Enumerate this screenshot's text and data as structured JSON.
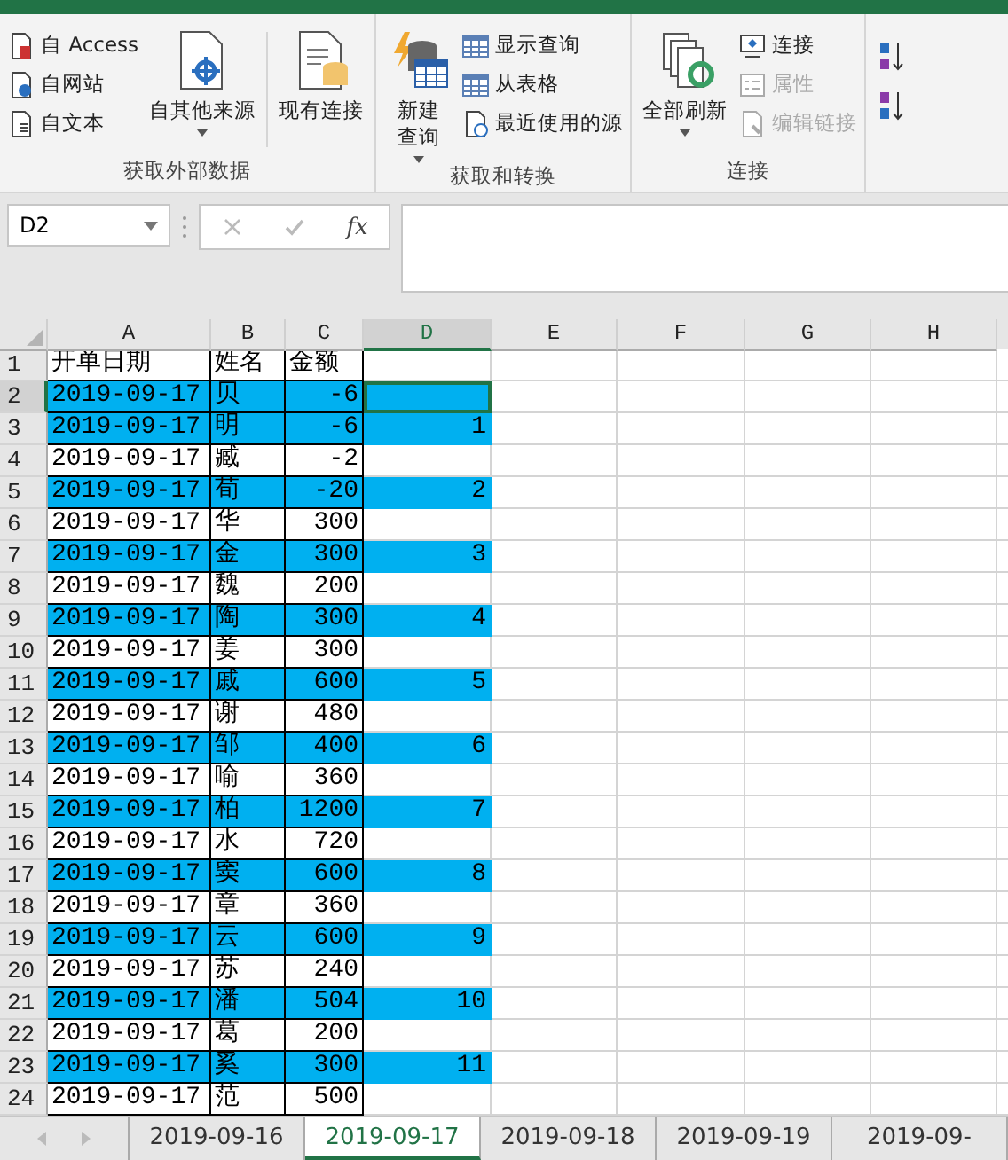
{
  "ribbon": {
    "groups": [
      {
        "label": "获取外部数据",
        "items": [
          {
            "kind": "stack",
            "buttons": [
              {
                "label": "自 Access",
                "disabled": false
              },
              {
                "label": "自网站",
                "disabled": false
              },
              {
                "label": "自文本",
                "disabled": false
              }
            ]
          },
          {
            "kind": "large",
            "lines": [
              "自其他来源"
            ],
            "dropdown": true
          },
          {
            "kind": "separator"
          },
          {
            "kind": "large",
            "lines": [
              "现有连接"
            ],
            "dropdown": false
          }
        ]
      },
      {
        "label": "获取和转换",
        "items": [
          {
            "kind": "large",
            "lines": [
              "新建",
              "查询"
            ],
            "dropdown": true
          },
          {
            "kind": "stack",
            "buttons": [
              {
                "label": "显示查询",
                "disabled": false
              },
              {
                "label": "从表格",
                "disabled": false
              },
              {
                "label": "最近使用的源",
                "disabled": false
              }
            ]
          }
        ]
      },
      {
        "label": "连接",
        "items": [
          {
            "kind": "large",
            "lines": [
              "全部刷新"
            ],
            "dropdown": true
          },
          {
            "kind": "stack",
            "buttons": [
              {
                "label": "连接",
                "disabled": false
              },
              {
                "label": "属性",
                "disabled": true
              },
              {
                "label": "编辑链接",
                "disabled": true
              }
            ]
          }
        ]
      }
    ]
  },
  "formula_bar": {
    "name_box": "D2",
    "fx": "fx"
  },
  "columns": [
    {
      "label": "A",
      "selected": false
    },
    {
      "label": "B",
      "selected": false
    },
    {
      "label": "C",
      "selected": false
    },
    {
      "label": "D",
      "selected": true
    },
    {
      "label": "E",
      "selected": false
    },
    {
      "label": "F",
      "selected": false
    },
    {
      "label": "G",
      "selected": false
    },
    {
      "label": "H",
      "selected": false
    }
  ],
  "header_row": {
    "num": "1",
    "cells": [
      "开单日期",
      "姓名",
      "金额"
    ]
  },
  "rows": [
    {
      "num": "2",
      "date": "2019-09-17",
      "name": "贝",
      "amount": "-6",
      "highlighted": true,
      "selected": true
    },
    {
      "num": "3",
      "date": "2019-09-17",
      "name": "明",
      "amount": "-6",
      "d": "1",
      "highlighted": true,
      "selected": false
    },
    {
      "num": "4",
      "date": "2019-09-17",
      "name": "臧",
      "amount": "-2",
      "highlighted": false,
      "selected": false
    },
    {
      "num": "5",
      "date": "2019-09-17",
      "name": "荀",
      "amount": "-20",
      "d": "2",
      "highlighted": true,
      "selected": false
    },
    {
      "num": "6",
      "date": "2019-09-17",
      "name": "华",
      "amount": "300",
      "highlighted": false,
      "selected": false
    },
    {
      "num": "7",
      "date": "2019-09-17",
      "name": "金",
      "amount": "300",
      "d": "3",
      "highlighted": true,
      "selected": false
    },
    {
      "num": "8",
      "date": "2019-09-17",
      "name": "魏",
      "amount": "200",
      "highlighted": false,
      "selected": false
    },
    {
      "num": "9",
      "date": "2019-09-17",
      "name": "陶",
      "amount": "300",
      "d": "4",
      "highlighted": true,
      "selected": false
    },
    {
      "num": "10",
      "date": "2019-09-17",
      "name": "姜",
      "amount": "300",
      "highlighted": false,
      "selected": false
    },
    {
      "num": "11",
      "date": "2019-09-17",
      "name": "戚",
      "amount": "600",
      "d": "5",
      "highlighted": true,
      "selected": false
    },
    {
      "num": "12",
      "date": "2019-09-17",
      "name": "谢",
      "amount": "480",
      "highlighted": false,
      "selected": false
    },
    {
      "num": "13",
      "date": "2019-09-17",
      "name": "邹",
      "amount": "400",
      "d": "6",
      "highlighted": true,
      "selected": false
    },
    {
      "num": "14",
      "date": "2019-09-17",
      "name": "喻",
      "amount": "360",
      "highlighted": false,
      "selected": false
    },
    {
      "num": "15",
      "date": "2019-09-17",
      "name": "柏",
      "amount": "1200",
      "d": "7",
      "highlighted": true,
      "selected": false
    },
    {
      "num": "16",
      "date": "2019-09-17",
      "name": "水",
      "amount": "720",
      "highlighted": false,
      "selected": false
    },
    {
      "num": "17",
      "date": "2019-09-17",
      "name": "窦",
      "amount": "600",
      "d": "8",
      "highlighted": true,
      "selected": false
    },
    {
      "num": "18",
      "date": "2019-09-17",
      "name": "章",
      "amount": "360",
      "highlighted": false,
      "selected": false
    },
    {
      "num": "19",
      "date": "2019-09-17",
      "name": "云",
      "amount": "600",
      "d": "9",
      "highlighted": true,
      "selected": false
    },
    {
      "num": "20",
      "date": "2019-09-17",
      "name": "苏",
      "amount": "240",
      "highlighted": false,
      "selected": false
    },
    {
      "num": "21",
      "date": "2019-09-17",
      "name": "潘",
      "amount": "504",
      "d": "10",
      "highlighted": true,
      "selected": false
    },
    {
      "num": "22",
      "date": "2019-09-17",
      "name": "葛",
      "amount": "200",
      "highlighted": false,
      "selected": false
    },
    {
      "num": "23",
      "date": "2019-09-17",
      "name": "奚",
      "amount": "300",
      "d": "11",
      "highlighted": true,
      "selected": false
    },
    {
      "num": "24",
      "date": "2019-09-17",
      "name": "范",
      "amount": "500",
      "highlighted": false,
      "selected": false
    }
  ],
  "sheet_tabs": [
    {
      "label": "2019-09-16",
      "selected": false
    },
    {
      "label": "2019-09-17",
      "selected": true
    },
    {
      "label": "2019-09-18",
      "selected": false
    },
    {
      "label": "2019-09-19",
      "selected": false
    },
    {
      "label": "2019-09-",
      "selected": false
    }
  ]
}
